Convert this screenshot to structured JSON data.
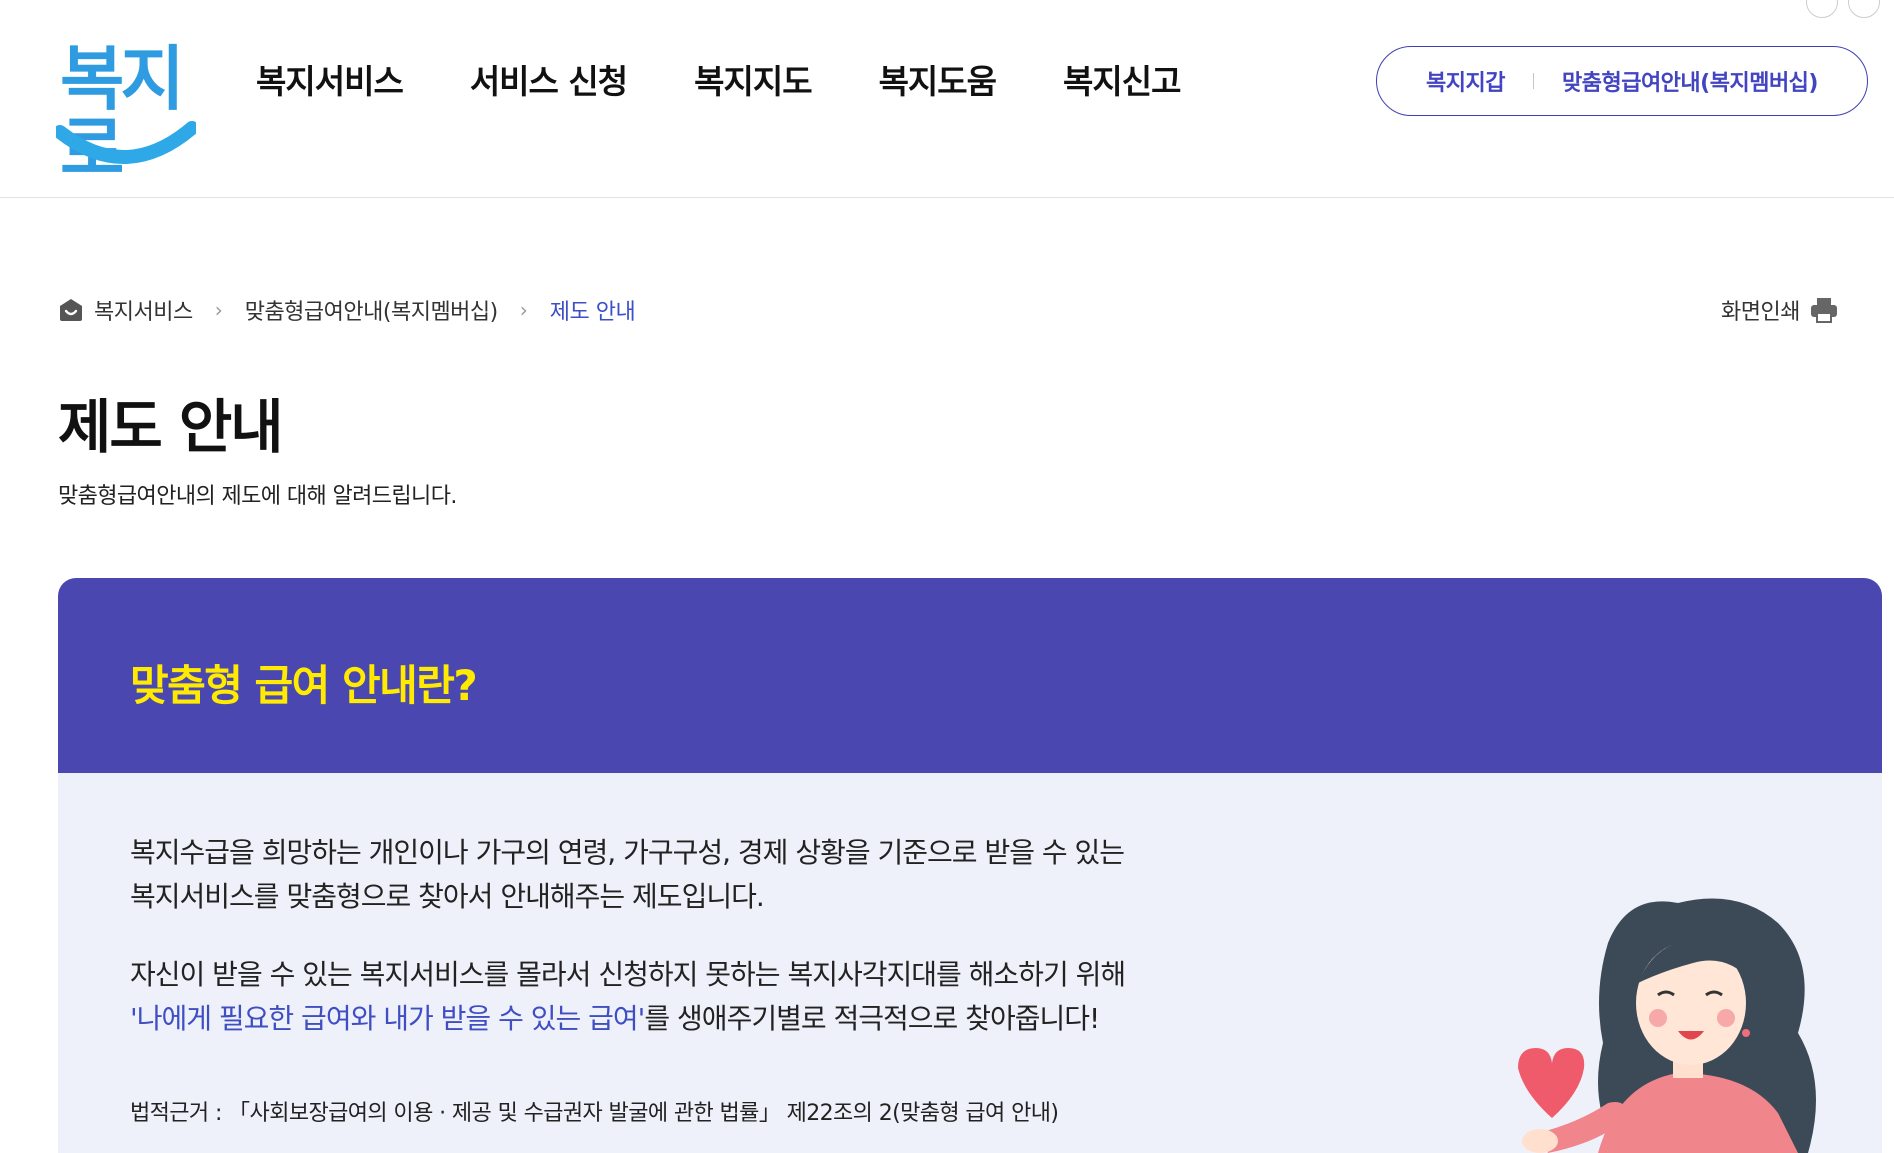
{
  "header": {
    "logo_text": "복지로",
    "nav": [
      "복지서비스",
      "서비스 신청",
      "복지지도",
      "복지도움",
      "복지신고"
    ],
    "util_links": [
      "복지지갑",
      "맞춤형급여안내(복지멤버십)"
    ]
  },
  "breadcrumb": {
    "items": [
      "복지서비스",
      "맞춤형급여안내(복지멤버십)"
    ],
    "current": "제도 안내"
  },
  "print_label": "화면인쇄",
  "page": {
    "title": "제도 안내",
    "description": "맞춤형급여안내의 제도에 대해 알려드립니다."
  },
  "card": {
    "title": "맞춤형 급여 안내란?",
    "para1_line1": "복지수급을 희망하는 개인이나 가구의 연령, 가구구성, 경제 상황을 기준으로 받을 수 있는",
    "para1_line2": "복지서비스를 맞춤형으로 찾아서 안내해주는 제도입니다.",
    "para2_line1": "자신이 받을 수 있는 복지서비스를 몰라서 신청하지 못하는 복지사각지대를 해소하기 위해",
    "para2_highlight": "'나에게 필요한 급여와 내가 받을 수 있는 급여'",
    "para2_rest": "를 생애주기별로 적극적으로 찾아줍니다!",
    "legal": "법적근거 : 「사회보장급여의 이용 · 제공 및 수급권자 발굴에 관한 법률」 제22조의 2(맞춤형 급여 안내)"
  },
  "colors": {
    "brand": "#4a48b0",
    "accent_yellow": "#ffea00",
    "link": "#3f4ec2",
    "card_bg": "#eff1fa"
  },
  "icons": [
    "home-icon",
    "chevron-right-icon",
    "printer-icon"
  ]
}
